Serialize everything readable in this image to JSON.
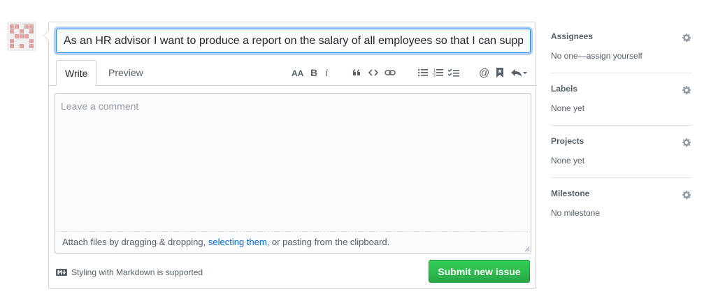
{
  "issue_form": {
    "title_value": "As an HR advisor I want to produce a report on the salary of all employees so that I can supp",
    "tabs": [
      {
        "label": "Write",
        "active": true
      },
      {
        "label": "Preview",
        "active": false
      }
    ],
    "toolbar_icons": [
      "text-size-icon",
      "bold-icon",
      "italic-icon",
      "quote-icon",
      "code-icon",
      "link-icon",
      "bulleted-list-icon",
      "numbered-list-icon",
      "task-list-icon",
      "mention-icon",
      "saved-reply-icon",
      "reply-icon"
    ],
    "comment_placeholder": "Leave a comment",
    "attach": {
      "before": "Attach files by dragging & dropping, ",
      "link": "selecting them",
      "after": ", or pasting from the clipboard."
    },
    "markdown_note": "Styling with Markdown is supported",
    "submit_label": "Submit new issue"
  },
  "sidebar": {
    "sections": [
      {
        "heading": "Assignees",
        "value": "No one—assign yourself"
      },
      {
        "heading": "Labels",
        "value": "None yet"
      },
      {
        "heading": "Projects",
        "value": "None yet"
      },
      {
        "heading": "Milestone",
        "value": "No milestone"
      }
    ]
  },
  "colors": {
    "accent": "#2188ff",
    "link": "#0366d6",
    "submit_green": "#28a745",
    "avatar": "#e0a5a3"
  }
}
